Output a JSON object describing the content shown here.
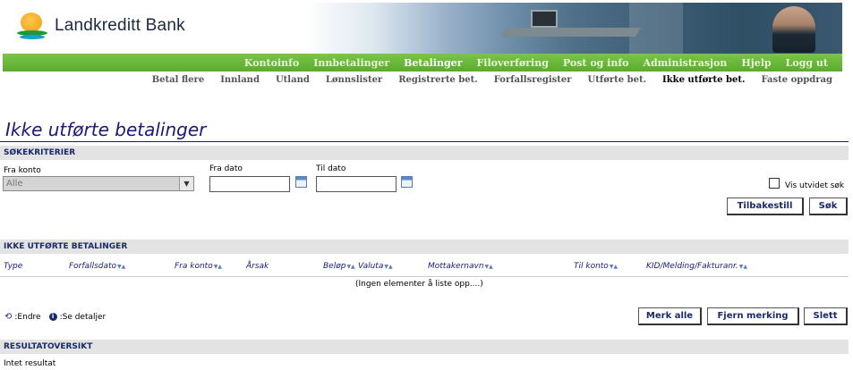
{
  "logo": {
    "name": "Landkreditt Bank",
    "icon": "sun-over-waves-logo"
  },
  "main_nav": {
    "items": [
      "Kontoinfo",
      "Innbetalinger",
      "Betalinger",
      "Filoverføring",
      "Post og info",
      "Administrasjon",
      "Hjelp",
      "Logg ut"
    ],
    "active": "Betalinger"
  },
  "sub_nav": {
    "items": [
      "Betal flere",
      "Innland",
      "Utland",
      "Lønnslister",
      "Registrerte bet.",
      "Forfallsregister",
      "Utførte bet.",
      "Ikke utførte bet.",
      "Faste oppdrag"
    ],
    "active": "Ikke utførte bet."
  },
  "page_title": "Ikke utførte betalinger",
  "search": {
    "section_title": "SØKEKRITERIER",
    "from_account_label": "Fra konto",
    "from_account_value": "Alle",
    "from_date_label": "Fra dato",
    "to_date_label": "Til dato",
    "extended_search_label": "Vis utvidet søk",
    "reset_button": "Tilbakestill",
    "search_button": "Søk"
  },
  "table": {
    "section_title": "IKKE UTFØRTE BETALINGER",
    "columns": [
      "Type",
      "Forfallsdato",
      "Fra konto",
      "Årsak",
      "Beløp",
      "Valuta",
      "Mottakernavn",
      "Til konto",
      "KID/Melding/Fakturanr."
    ],
    "empty_message": "(Ingen elementer å liste opp....)"
  },
  "legend": {
    "edit": ":Endre",
    "details": ":Se detaljer"
  },
  "actions": {
    "mark_all": "Merk alle",
    "unmark": "Fjern merking",
    "delete": "Slett"
  },
  "results": {
    "section_title": "RESULTATOVERSIKT",
    "text": "Intet resultat"
  },
  "colors": {
    "nav_green": "#5aab2c",
    "title_blue": "#1a1a7a",
    "section_gray": "#e3e3e3"
  }
}
